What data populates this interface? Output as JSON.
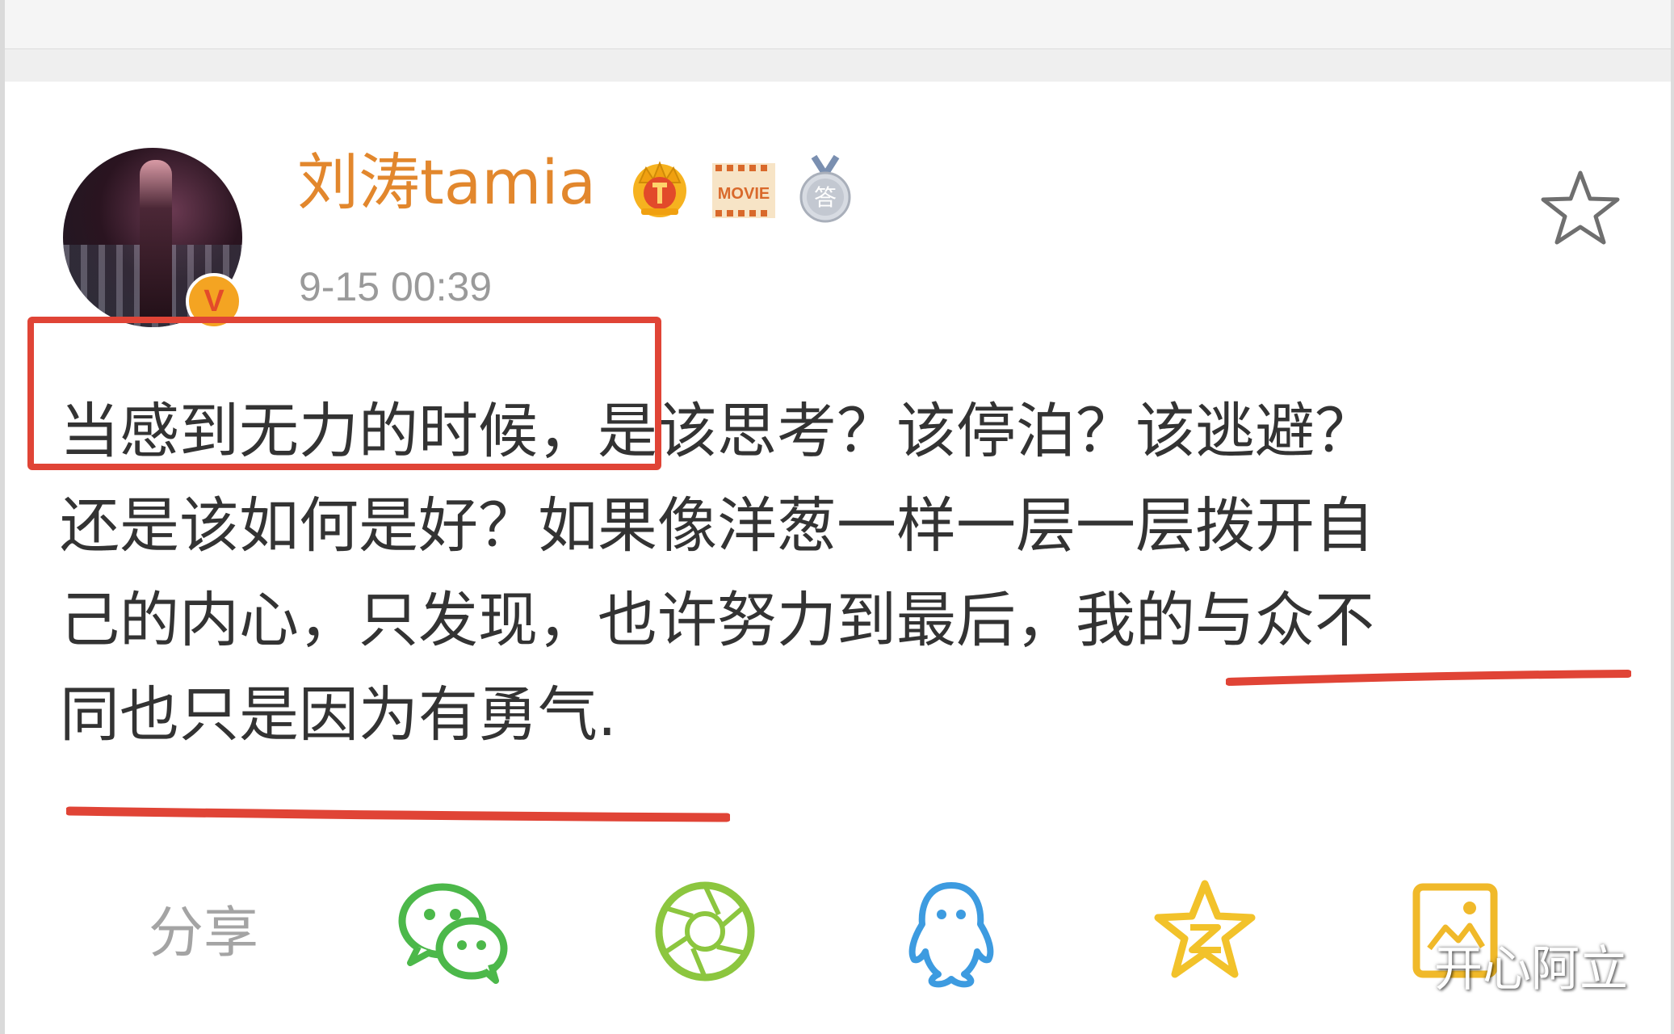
{
  "post": {
    "username": "刘涛tamia",
    "badge_letter": "V",
    "timestamp": "9-15 00:39",
    "text_lines": [
      "当感到无力的时候，是该思考？该停泊？该逃避？",
      "还是该如何是好？如果像洋葱一样一层一层拨开自",
      "己的内心，只发现，也许努力到最后，我的与众不",
      "同也只是因为有勇气."
    ],
    "movie_badge_text": "MOVIE",
    "medal_badge_text": "答"
  },
  "share": {
    "label": "分享",
    "icons": [
      "wechat-icon",
      "moments-icon",
      "qq-icon",
      "qzone-icon",
      "album-icon"
    ]
  },
  "watermark": "开心阿立",
  "colors": {
    "username": "#e2872d",
    "timestamp": "#9a9a9a",
    "body_text": "#333333",
    "annotation_red": "#e04436",
    "wechat_green": "#4cb84a",
    "moments_green": "#8cc63f",
    "qq_blue": "#3d9be0",
    "qzone_yellow": "#f2c22a",
    "album_yellow": "#f0b92a"
  }
}
